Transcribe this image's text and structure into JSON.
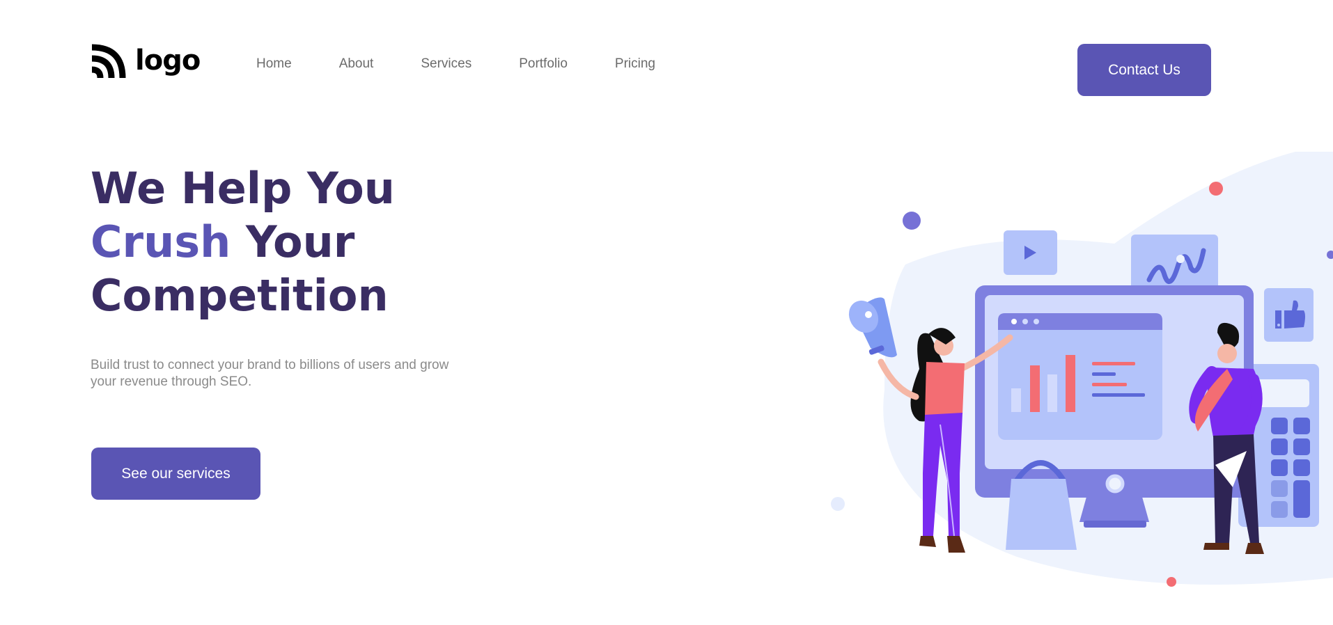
{
  "brand": {
    "logo_text": "logo"
  },
  "nav": {
    "items": [
      {
        "label": "Home"
      },
      {
        "label": "About"
      },
      {
        "label": "Services"
      },
      {
        "label": "Portfolio"
      },
      {
        "label": "Pricing"
      }
    ],
    "contact_label": "Contact Us"
  },
  "hero": {
    "line1": "We Help You",
    "line2_accent": "Crush",
    "line2_rest": " Your",
    "line3": "Competition",
    "subtitle": "Build trust to connect your brand to billions of users and grow your revenue through SEO.",
    "cta_label": "See our services"
  },
  "colors": {
    "primary": "#5a55b4",
    "heading": "#3a2d63",
    "body_text": "#8a8a8a",
    "nav_text": "#6b6b6b",
    "accent_pink": "#f36d73",
    "bg_blob": "#eef3fd"
  },
  "illustration": {
    "icons": [
      "megaphone-icon",
      "play-icon",
      "trend-chart-icon",
      "thumbs-up-icon",
      "shopping-bag-icon",
      "calculator-icon",
      "monitor-icon"
    ]
  }
}
